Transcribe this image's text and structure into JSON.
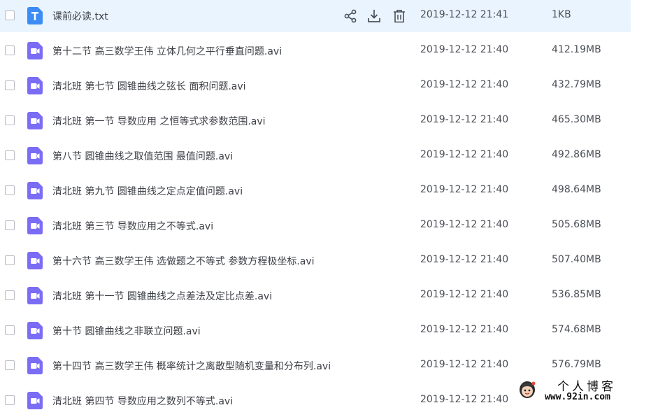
{
  "files": [
    {
      "name": "课前必读.txt",
      "date": "2019-12-12 21:41",
      "size": "1KB",
      "type": "txt"
    },
    {
      "name": "第十二节 高三数学王伟 立体几何之平行垂直问题.avi",
      "date": "2019-12-12 21:40",
      "size": "412.19MB",
      "type": "video"
    },
    {
      "name": "清北班 第七节 圆锥曲线之弦长 面积问题.avi",
      "date": "2019-12-12 21:40",
      "size": "432.79MB",
      "type": "video"
    },
    {
      "name": "清北班 第一节 导数应用 之恒等式求参数范围.avi",
      "date": "2019-12-12 21:40",
      "size": "465.30MB",
      "type": "video"
    },
    {
      "name": "第八节 圆锥曲线之取值范围 最值问题.avi",
      "date": "2019-12-12 21:40",
      "size": "492.86MB",
      "type": "video"
    },
    {
      "name": "清北班  第九节 圆锥曲线之定点定值问题.avi",
      "date": "2019-12-12 21:40",
      "size": "498.64MB",
      "type": "video"
    },
    {
      "name": "清北班 第三节 导数应用之不等式.avi",
      "date": "2019-12-12 21:40",
      "size": "505.68MB",
      "type": "video"
    },
    {
      "name": "第十六节 高三数学王伟 选做题之不等式 参数方程极坐标.avi",
      "date": "2019-12-12 21:40",
      "size": "507.40MB",
      "type": "video"
    },
    {
      "name": "清北班 第十一节 圆锥曲线之点差法及定比点差.avi",
      "date": "2019-12-12 21:40",
      "size": "536.85MB",
      "type": "video"
    },
    {
      "name": "第十节 圆锥曲线之非联立问题.avi",
      "date": "2019-12-12 21:40",
      "size": "574.68MB",
      "type": "video"
    },
    {
      "name": "第十四节 高三数学王伟 概率统计之离散型随机变量和分布列.avi",
      "date": "2019-12-12 21:40",
      "size": "576.79MB",
      "type": "video"
    },
    {
      "name": "清北班 第四节 导数应用之数列不等式.avi",
      "date": "2019-12-12 21:40",
      "size": "",
      "type": "video"
    }
  ],
  "icons": {
    "txt_file": "txt-file-icon",
    "video_file": "video-file-icon",
    "share": "share-icon",
    "download": "download-icon",
    "delete": "trash-icon"
  },
  "colors": {
    "hover_row": "#eaf4fe",
    "txt_icon": "#3b8cf5",
    "video_icon": "#7b6cf6",
    "text": "#3c3f45"
  },
  "watermark": {
    "title": "个人博客",
    "url": "www.92in.com"
  }
}
